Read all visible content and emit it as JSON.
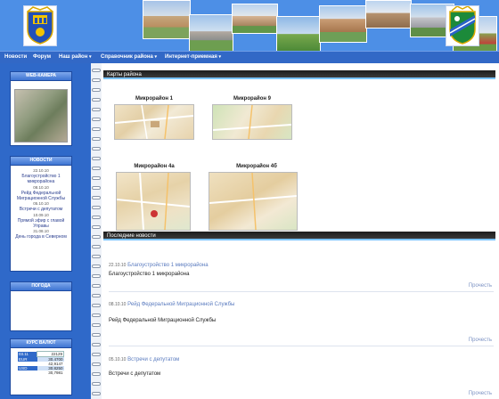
{
  "header": {
    "emblem_left": "district-coat-of-arms",
    "emblem_right": "area-coat-of-arms"
  },
  "nav": [
    {
      "label": "Новости",
      "dropdown": false
    },
    {
      "label": "Форум",
      "dropdown": false
    },
    {
      "label": "Наш район",
      "dropdown": true
    },
    {
      "label": "Справочник района",
      "dropdown": true
    },
    {
      "label": "Интернет-приемная",
      "dropdown": true
    }
  ],
  "sidebar": {
    "webcam_title": "WEB-КАМЕРА",
    "news_title": "НОВОСТИ",
    "news": [
      {
        "date": "22.10.10",
        "title": "Благоустройство 1 микрорайона"
      },
      {
        "date": "08.10.10",
        "title": "Рейд Федеральной Миграционной Службы"
      },
      {
        "date": "05.10.10",
        "title": "Встречи с депутатом"
      },
      {
        "date": "10.09.10",
        "title": "Прямой эфир с главой Управы"
      },
      {
        "date": "31.08.10",
        "title": "День города в Северном"
      }
    ],
    "weather_title": "ПОГОДА",
    "currency_title": "КУРС ВАЛЮТ",
    "currency": [
      {
        "label": "03.11",
        "value": "22129"
      },
      {
        "label": "EUR",
        "value": "30.4700"
      },
      {
        "label": "",
        "value": "42,9147"
      },
      {
        "label": "USD",
        "value": "30.8250"
      },
      {
        "label": "",
        "value": "30,7981"
      }
    ]
  },
  "maps": {
    "section_title": "Карты района",
    "items": [
      {
        "title": "Микрорайон 1"
      },
      {
        "title": "Микрорайон 9"
      },
      {
        "title": "Микрорайон 4а"
      },
      {
        "title": "Микрорайон 4б"
      }
    ]
  },
  "latest_news": {
    "section_title": "Последние новости",
    "more_label": "Прочесть",
    "items": [
      {
        "date": "22.10.10",
        "link": "Благоустройство 1 микрорайона",
        "text": "Благоустройство 1 микрорайона"
      },
      {
        "date": "08.10.10",
        "link": "Рейд Федеральной Миграционной Службы",
        "text": "Рейд Федеральной Миграционной Службы"
      },
      {
        "date": "05.10.10",
        "link": "Встречи с депутатом",
        "text": "Встречи с депутатом"
      }
    ]
  }
}
